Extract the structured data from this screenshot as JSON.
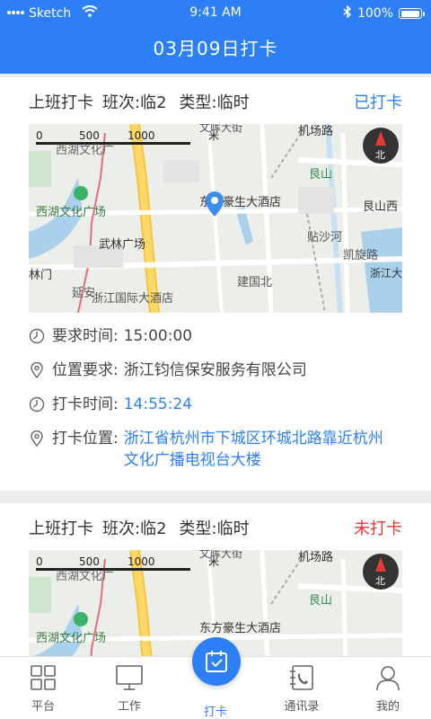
{
  "status_bar": {
    "carrier": "Sketch",
    "time": "9:41 AM",
    "battery": "100%",
    "battery_level": 1.0
  },
  "header": {
    "title": "03月09日打卡"
  },
  "cards": [
    {
      "title": "上班打卡",
      "shift": "班次:临2",
      "type": "类型:临时",
      "status": "已打卡",
      "status_color": "#2d7ff5",
      "required_time_label": "要求时间:",
      "required_time": "15:00:00",
      "location_req_label": "位置要求:",
      "location_req": "浙江钧信保安服务有限公司",
      "punch_time_label": "打卡时间:",
      "punch_time": "14:55:24",
      "punch_loc_label": "打卡位置:",
      "punch_loc": "浙江省杭州市下城区环城北路靠近杭州文化广播电视台大楼"
    },
    {
      "title": "上班打卡",
      "shift": "班次:临2",
      "type": "类型:临时",
      "status": "未打卡",
      "status_color": "#e53935"
    }
  ],
  "map": {
    "scale": [
      "0",
      "500",
      "1000",
      "米"
    ],
    "compass": "北",
    "labels": {
      "ximu": "西湖文化广场",
      "ximu_top": "西湖文化广",
      "wulin": "武林广场",
      "intl": "浙江国际大酒店",
      "dongfang": "东方豪生大酒店",
      "gensan": "艮山",
      "gensan_west": "艮山西",
      "jichang": "机场路",
      "wenhui": "文晖大街",
      "tiansha": "贴沙河",
      "kaixuan": "凯旋路",
      "jiachi": "浙江大家池校",
      "jianguo": "建国北",
      "yanan": "延安",
      "wenmen": "林门"
    }
  },
  "tabbar": {
    "items": [
      {
        "label": "平台",
        "icon": "grid-icon"
      },
      {
        "label": "工作",
        "icon": "monitor-icon"
      },
      {
        "label": "打卡",
        "icon": "checkin-icon"
      },
      {
        "label": "通讯录",
        "icon": "contacts-icon"
      },
      {
        "label": "我的",
        "icon": "user-icon"
      }
    ]
  },
  "colors": {
    "primary": "#2d7ff5",
    "danger": "#e53935"
  }
}
